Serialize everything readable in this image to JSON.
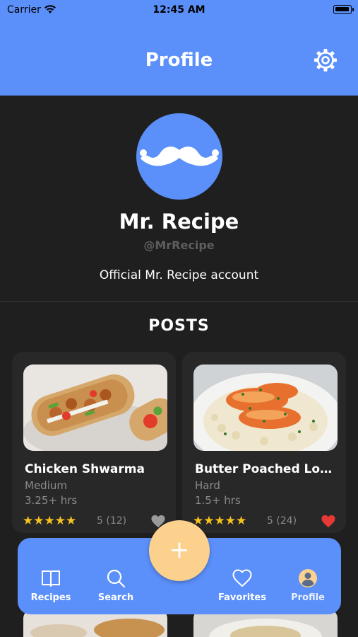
{
  "status_bar": {
    "carrier": "Carrier",
    "time": "12:45 AM"
  },
  "header": {
    "title": "Profile",
    "settings_icon": "gear-icon"
  },
  "profile": {
    "name": "Mr. Recipe",
    "handle": "@MrRecipe",
    "bio": "Official Mr. Recipe account",
    "avatar_icon": "mustache-icon"
  },
  "posts": {
    "title": "POSTS",
    "items": [
      {
        "title": "Chicken Shwarma",
        "difficulty": "Medium",
        "time": "3.25+ hrs",
        "stars": "★★★★★",
        "rating": "5 (12)",
        "favorited": false
      },
      {
        "title": "Butter Poached Lobster",
        "difficulty": "Hard",
        "time": "1.5+ hrs",
        "stars": "★★★★★",
        "rating": "5 (24)",
        "favorited": true
      }
    ]
  },
  "tabbar": {
    "items": [
      {
        "label": "Recipes",
        "icon": "book-icon"
      },
      {
        "label": "Search",
        "icon": "search-icon"
      },
      {
        "label": "Favorites",
        "icon": "heart-icon"
      },
      {
        "label": "Profile",
        "icon": "user-icon",
        "active": true
      }
    ],
    "fab_label": "+"
  },
  "colors": {
    "accent": "#5b8ff9",
    "background": "#1f1f1f",
    "card": "#282828",
    "fab": "#fcd18e",
    "star": "#f6c21c",
    "heart_active": "#e53935",
    "heart_inactive": "#9a9a9a"
  }
}
